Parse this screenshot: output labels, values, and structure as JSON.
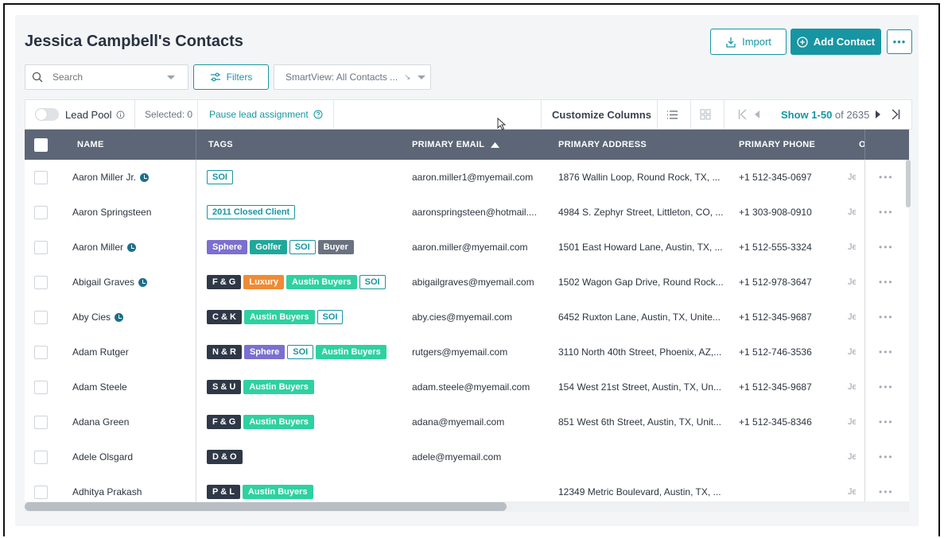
{
  "page": {
    "title": "Jessica Campbell's Contacts"
  },
  "actions": {
    "import_label": "Import",
    "add_contact_label": "Add Contact",
    "more_label": "•••"
  },
  "search": {
    "placeholder": "Search"
  },
  "filters": {
    "label": "Filters"
  },
  "smartview": {
    "value": "SmartView: All Contacts ..."
  },
  "toolbar": {
    "lead_pool_label": "Lead Pool",
    "selected_label": "Selected: 0",
    "pause_label": "Pause lead assignment",
    "customize_label": "Customize Columns",
    "pagination_range": "Show 1-50",
    "pagination_total": "of 2635"
  },
  "columns": {
    "name": "NAME",
    "tags": "TAGS",
    "email": "PRIMARY EMAIL",
    "address": "PRIMARY ADDRESS",
    "phone": "PRIMARY PHONE",
    "extra": "O"
  },
  "colors": {
    "accent": "#1795a3",
    "header_bg": "#5d6676",
    "lead_icon": "#1c6f8c"
  },
  "tag_styles": {
    "outline": {
      "bg": "#ffffff",
      "fg": "#1795a3",
      "border": "#1795a3"
    },
    "purple": {
      "bg": "#7b6fd0",
      "fg": "#ffffff",
      "border": "#7b6fd0"
    },
    "teal": {
      "bg": "#1fa89a",
      "fg": "#ffffff",
      "border": "#1fa89a"
    },
    "green": {
      "bg": "#2ed1a1",
      "fg": "#ffffff",
      "border": "#2ed1a1"
    },
    "gray": {
      "bg": "#6a7280",
      "fg": "#ffffff",
      "border": "#6a7280"
    },
    "navy": {
      "bg": "#2f3847",
      "fg": "#ffffff",
      "border": "#2f3847"
    },
    "orange": {
      "bg": "#f08a35",
      "fg": "#ffffff",
      "border": "#f08a35"
    }
  },
  "rows": [
    {
      "name": "Aaron Miller Jr.",
      "lead": true,
      "tags": [
        {
          "label": "SOI",
          "style": "outline"
        }
      ],
      "email": "aaron.miller1@myemail.com",
      "address": "1876 Wallin Loop, Round Rock, TX, ...",
      "phone": "+1 512-345-0697",
      "extra": "Je"
    },
    {
      "name": "Aaron Springsteen",
      "lead": false,
      "tags": [
        {
          "label": "2011 Closed Client",
          "style": "outline"
        }
      ],
      "email": "aaronspringsteen@hotmail....",
      "address": "4984 S. Zephyr Street, Littleton, CO, ...",
      "phone": "+1 303-908-0910",
      "extra": "Je"
    },
    {
      "name": "Aaron Miller",
      "lead": true,
      "tags": [
        {
          "label": "Sphere",
          "style": "purple"
        },
        {
          "label": "Golfer",
          "style": "teal"
        },
        {
          "label": "SOI",
          "style": "outline"
        },
        {
          "label": "Buyer",
          "style": "gray"
        }
      ],
      "email": "aaron.miller@myemail.com",
      "address": "1501 East Howard Lane, Austin, TX, ...",
      "phone": "+1 512-555-3324",
      "extra": "Je"
    },
    {
      "name": "Abigail Graves",
      "lead": true,
      "tags": [
        {
          "label": "F & G",
          "style": "navy"
        },
        {
          "label": "Luxury",
          "style": "orange"
        },
        {
          "label": "Austin Buyers",
          "style": "green"
        },
        {
          "label": "SOI",
          "style": "outline"
        }
      ],
      "email": "abigailgraves@myemail.com",
      "address": "1502 Wagon Gap Drive, Round Rock...",
      "phone": "+1 512-978-3647",
      "extra": "Je"
    },
    {
      "name": "Aby Cies",
      "lead": true,
      "tags": [
        {
          "label": "C & K",
          "style": "navy"
        },
        {
          "label": "Austin Buyers",
          "style": "green"
        },
        {
          "label": "SOI",
          "style": "outline"
        }
      ],
      "email": "aby.cies@myemail.com",
      "address": "6452 Ruxton Lane, Austin, TX, Unite...",
      "phone": "+1 512-345-9687",
      "extra": "Je"
    },
    {
      "name": "Adam Rutger",
      "lead": false,
      "tags": [
        {
          "label": "N & R",
          "style": "navy"
        },
        {
          "label": "Sphere",
          "style": "purple"
        },
        {
          "label": "SOI",
          "style": "outline"
        },
        {
          "label": "Austin Buyers",
          "style": "green"
        }
      ],
      "email": "rutgers@myemail.com",
      "address": "3110 North 40th Street, Phoenix, AZ,...",
      "phone": "+1 512-746-3536",
      "extra": "Je"
    },
    {
      "name": "Adam Steele",
      "lead": false,
      "tags": [
        {
          "label": "S & U",
          "style": "navy"
        },
        {
          "label": "Austin Buyers",
          "style": "green"
        }
      ],
      "email": "adam.steele@myemail.com",
      "address": "154 West 21st Street, Austin, TX, Un...",
      "phone": "+1 512-345-9687",
      "extra": "Je"
    },
    {
      "name": "Adana Green",
      "lead": false,
      "tags": [
        {
          "label": "F & G",
          "style": "navy"
        },
        {
          "label": "Austin Buyers",
          "style": "green"
        }
      ],
      "email": "adana@myemail.com",
      "address": "851 West 6th Street, Austin, TX, Unit...",
      "phone": "+1 512-345-8346",
      "extra": "Je"
    },
    {
      "name": "Adele Olsgard",
      "lead": false,
      "tags": [
        {
          "label": "D & O",
          "style": "navy"
        }
      ],
      "email": "adele@myemail.com",
      "address": "",
      "phone": "",
      "extra": "Je"
    },
    {
      "name": "Adhitya Prakash",
      "lead": false,
      "tags": [
        {
          "label": "P & L",
          "style": "navy"
        },
        {
          "label": "Austin Buyers",
          "style": "green"
        }
      ],
      "email": "",
      "address": "12349 Metric Boulevard, Austin, TX, ...",
      "phone": "",
      "extra": "Je"
    }
  ]
}
